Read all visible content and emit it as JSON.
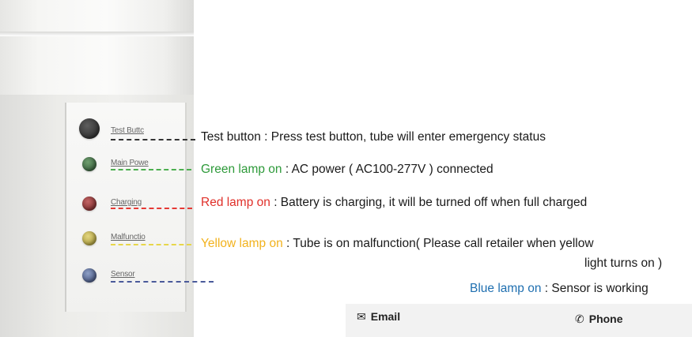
{
  "panel_labels": {
    "test": "Test Buttc",
    "main_power": "Main Powe",
    "charging": "Charging",
    "malfunction": "Malfunctio",
    "sensor": "Sensor"
  },
  "descriptions": {
    "test": "Test button : Press test button, tube will enter emergency status",
    "green_lead": "Green lamp on",
    "green_text": " : AC power ( AC100-277V ) connected",
    "red_lead": "Red lamp on",
    "red_text": " : Battery is charging, it will be turned off when full charged",
    "yellow_lead": "Yellow lamp on",
    "yellow_text": " : Tube is on malfunction( Please call retailer when yellow",
    "yellow_cont": "light turns on )",
    "blue_lead": "Blue lamp on",
    "blue_text": " : Sensor is working"
  },
  "contact": {
    "email_label": "Email",
    "phone_label": "Phone",
    "email_icon": "envelope-icon",
    "phone_icon": "phone-icon"
  },
  "colors": {
    "green": "#2e9a3a",
    "red": "#e0302a",
    "yellow": "#f2b21d",
    "blue": "#1f6fb0"
  }
}
